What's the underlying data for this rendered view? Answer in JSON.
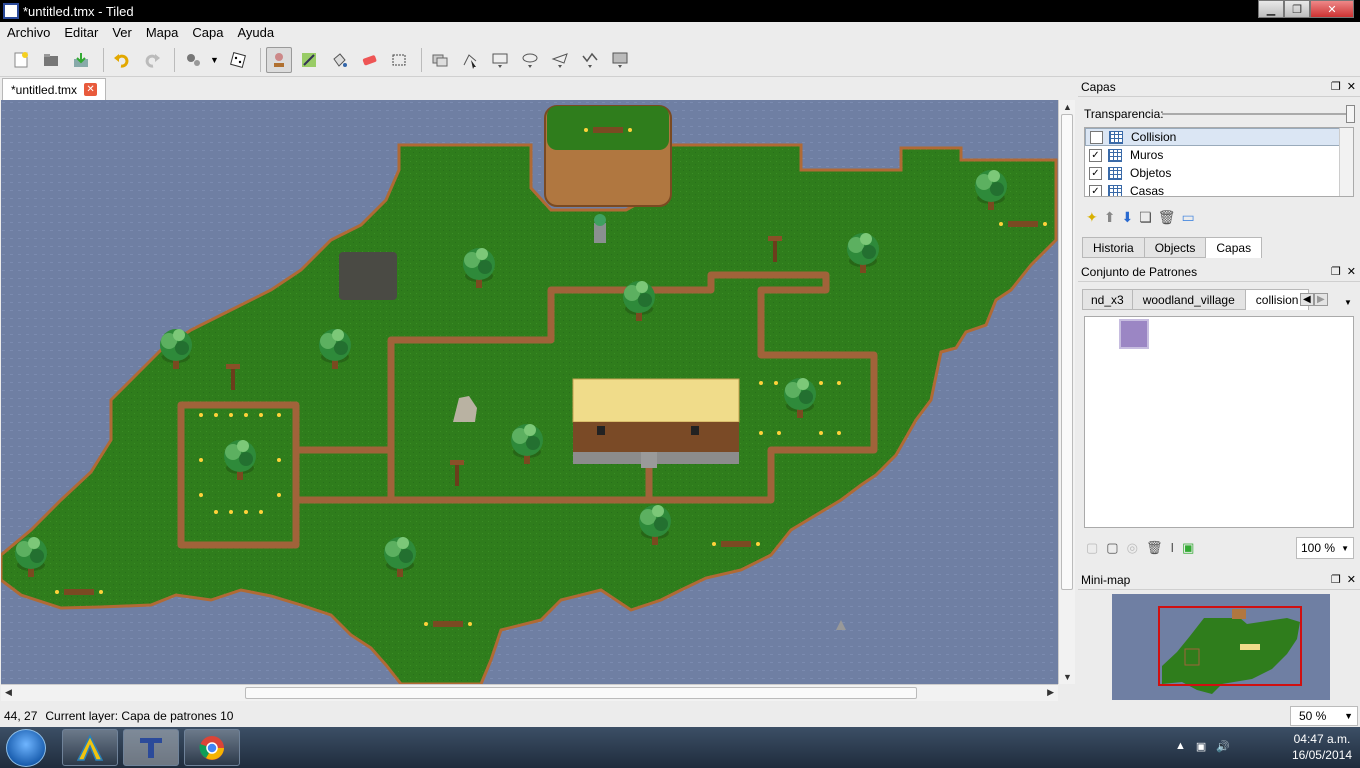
{
  "window": {
    "title": "*untitled.tmx - Tiled",
    "min": "▁",
    "max": "❐",
    "close": "✕"
  },
  "menu": [
    "Archivo",
    "Editar",
    "Ver",
    "Mapa",
    "Capa",
    "Ayuda"
  ],
  "toolbar": {
    "icons": [
      "new-file-icon",
      "open-folder-icon",
      "save-icon",
      "undo-icon",
      "redo-icon",
      "random-mode-icon",
      "stamp-brush-icon",
      "terrain-brush-icon",
      "bucket-fill-icon",
      "eraser-icon",
      "rect-select-icon",
      "object-select-icon",
      "edit-polygon-icon",
      "insert-rect-icon",
      "insert-ellipse-icon",
      "insert-polygon-icon",
      "insert-polyline-icon",
      "insert-tile-icon"
    ]
  },
  "document": {
    "tab_label": "*untitled.tmx",
    "close": "✕"
  },
  "status": {
    "coords": "44, 27",
    "layer": "Current layer: Capa de patrones 10",
    "zoom": "50 %"
  },
  "layers_panel": {
    "title": "Capas",
    "opacity_label": "Transparencia:",
    "layers": [
      {
        "name": "Collision",
        "visible": false,
        "selected": true
      },
      {
        "name": "Muros",
        "visible": true
      },
      {
        "name": "Objetos",
        "visible": true
      },
      {
        "name": "Casas",
        "visible": true
      }
    ],
    "tabs": [
      "Historia",
      "Objects",
      "Capas"
    ],
    "active_tab": "Capas"
  },
  "tileset_panel": {
    "title": "Conjunto de Patrones",
    "tabs": [
      "nd_x3",
      "woodland_village",
      "collision"
    ],
    "active_tab": "collision",
    "zoom": "100 %",
    "tile_color": "#9b86c4"
  },
  "minimap_panel": {
    "title": "Mini-map"
  },
  "colors": {
    "water": "#6f7fa3",
    "grass": "#2f7d1c",
    "path": "#a0633a",
    "roof": "#f0dc8a"
  },
  "taskbar": {
    "time": "04:47 a.m.",
    "date": "16/05/2014"
  }
}
